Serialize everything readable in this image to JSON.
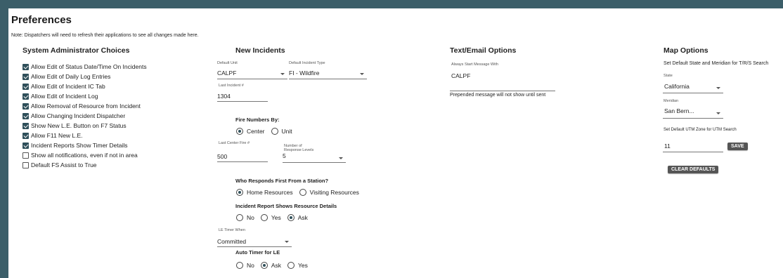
{
  "page": {
    "title": "Preferences",
    "note": "Note: Dispatchers will need to refresh their applications to see all changes made here."
  },
  "sysadmin": {
    "heading": "System Administrator Choices",
    "items": [
      {
        "label": "Allow Edit of Status Date/Time On Incidents",
        "checked": true
      },
      {
        "label": "Allow Edit of Daily Log Entries",
        "checked": true
      },
      {
        "label": "Allow Edit of Incident IC Tab",
        "checked": true
      },
      {
        "label": "Allow Edit of Incident Log",
        "checked": true
      },
      {
        "label": "Allow Removal of Resource from Incident",
        "checked": true
      },
      {
        "label": "Allow Changing Incident Dispatcher",
        "checked": true
      },
      {
        "label": "Show New L.E. Button on F7 Status",
        "checked": true
      },
      {
        "label": "Allow F11 New L.E.",
        "checked": true
      },
      {
        "label": "Incident Reports Show Timer Details",
        "checked": true
      },
      {
        "label": "Show all notifications, even if not in area",
        "checked": false
      },
      {
        "label": "Default FS Assist to True",
        "checked": false
      }
    ]
  },
  "incidents": {
    "heading": "New Incidents",
    "default_unit": {
      "label": "Default Unit",
      "value": "CALPF"
    },
    "default_type": {
      "label": "Default Incident Type",
      "value": "FI - Wildfire"
    },
    "last_incident": {
      "label": "Last Incident #",
      "value": "1304"
    },
    "fire_numbers": {
      "label": "Fire Numbers By:",
      "options": [
        "Center",
        "Unit"
      ],
      "selected": 0
    },
    "last_center_fire": {
      "label": "Last Center Fire #",
      "value": "500"
    },
    "response_levels": {
      "label": "Number of Response Levels",
      "value": "5"
    },
    "who_responds": {
      "label": "Who Responds First From a Station?",
      "options": [
        "Home Resources",
        "Visiting Resources"
      ],
      "selected": 0
    },
    "report_details": {
      "label": "Incident Report Shows Resource Details",
      "options": [
        "No",
        "Yes",
        "Ask"
      ],
      "selected": 2
    },
    "le_timer": {
      "label": "LE Timer When",
      "value": "Committed"
    },
    "auto_timer": {
      "label": "Auto Timer for LE",
      "options": [
        "No",
        "Ask",
        "Yes"
      ],
      "selected": 1
    }
  },
  "text_email": {
    "heading": "Text/Email Options",
    "start_label": "Always Start Message With",
    "start_value": "CALPF",
    "hint": "Prepended message will not show until sent"
  },
  "map": {
    "heading": "Map Options",
    "subheading": "Set Default State and Meridian for T/R/S Search",
    "state": {
      "label": "State",
      "value": "California"
    },
    "meridian": {
      "label": "Meridian",
      "value": "San Bern..."
    },
    "utm_label": "Set Default UTM Zone for UTM Search",
    "utm_value": "11",
    "save_label": "SAVE",
    "clear_label": "CLEAR DEFAULTS"
  },
  "colors": {
    "frame": "#3b5e69",
    "accent": "#2f4f5a",
    "button": "#555555"
  }
}
